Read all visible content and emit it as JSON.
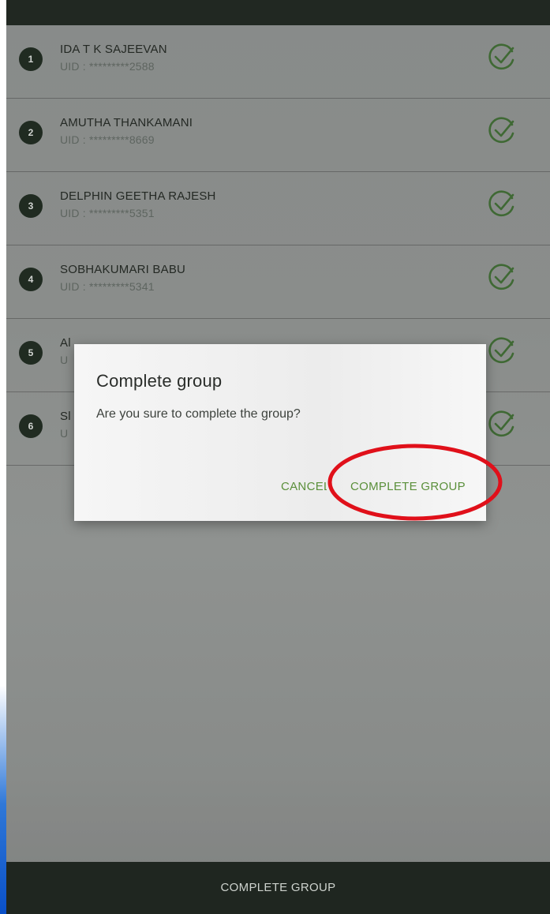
{
  "members": [
    {
      "index": "1",
      "name": "IDA T K SAJEEVAN",
      "uid": "UID : *********2588"
    },
    {
      "index": "2",
      "name": "AMUTHA THANKAMANI",
      "uid": "UID : *********8669"
    },
    {
      "index": "3",
      "name": "DELPHIN GEETHA RAJESH",
      "uid": "UID : *********5351"
    },
    {
      "index": "4",
      "name": "SOBHAKUMARI BABU",
      "uid": "UID : *********5341"
    },
    {
      "index": "5",
      "name": "Al",
      "uid": "U"
    },
    {
      "index": "6",
      "name": "Sl",
      "uid": "U"
    }
  ],
  "dialog": {
    "title": "Complete group",
    "message": "Are you sure to complete the group?",
    "cancel_label": "CANCEL",
    "confirm_label": "COMPLETE GROUP"
  },
  "bottom_bar": {
    "label": "COMPLETE GROUP"
  },
  "colors": {
    "accent_green": "#5a8f3a",
    "highlight_red": "#e0101a",
    "bar_dark": "#1f2620"
  },
  "icons": {
    "row_status": "check-circle-icon"
  }
}
